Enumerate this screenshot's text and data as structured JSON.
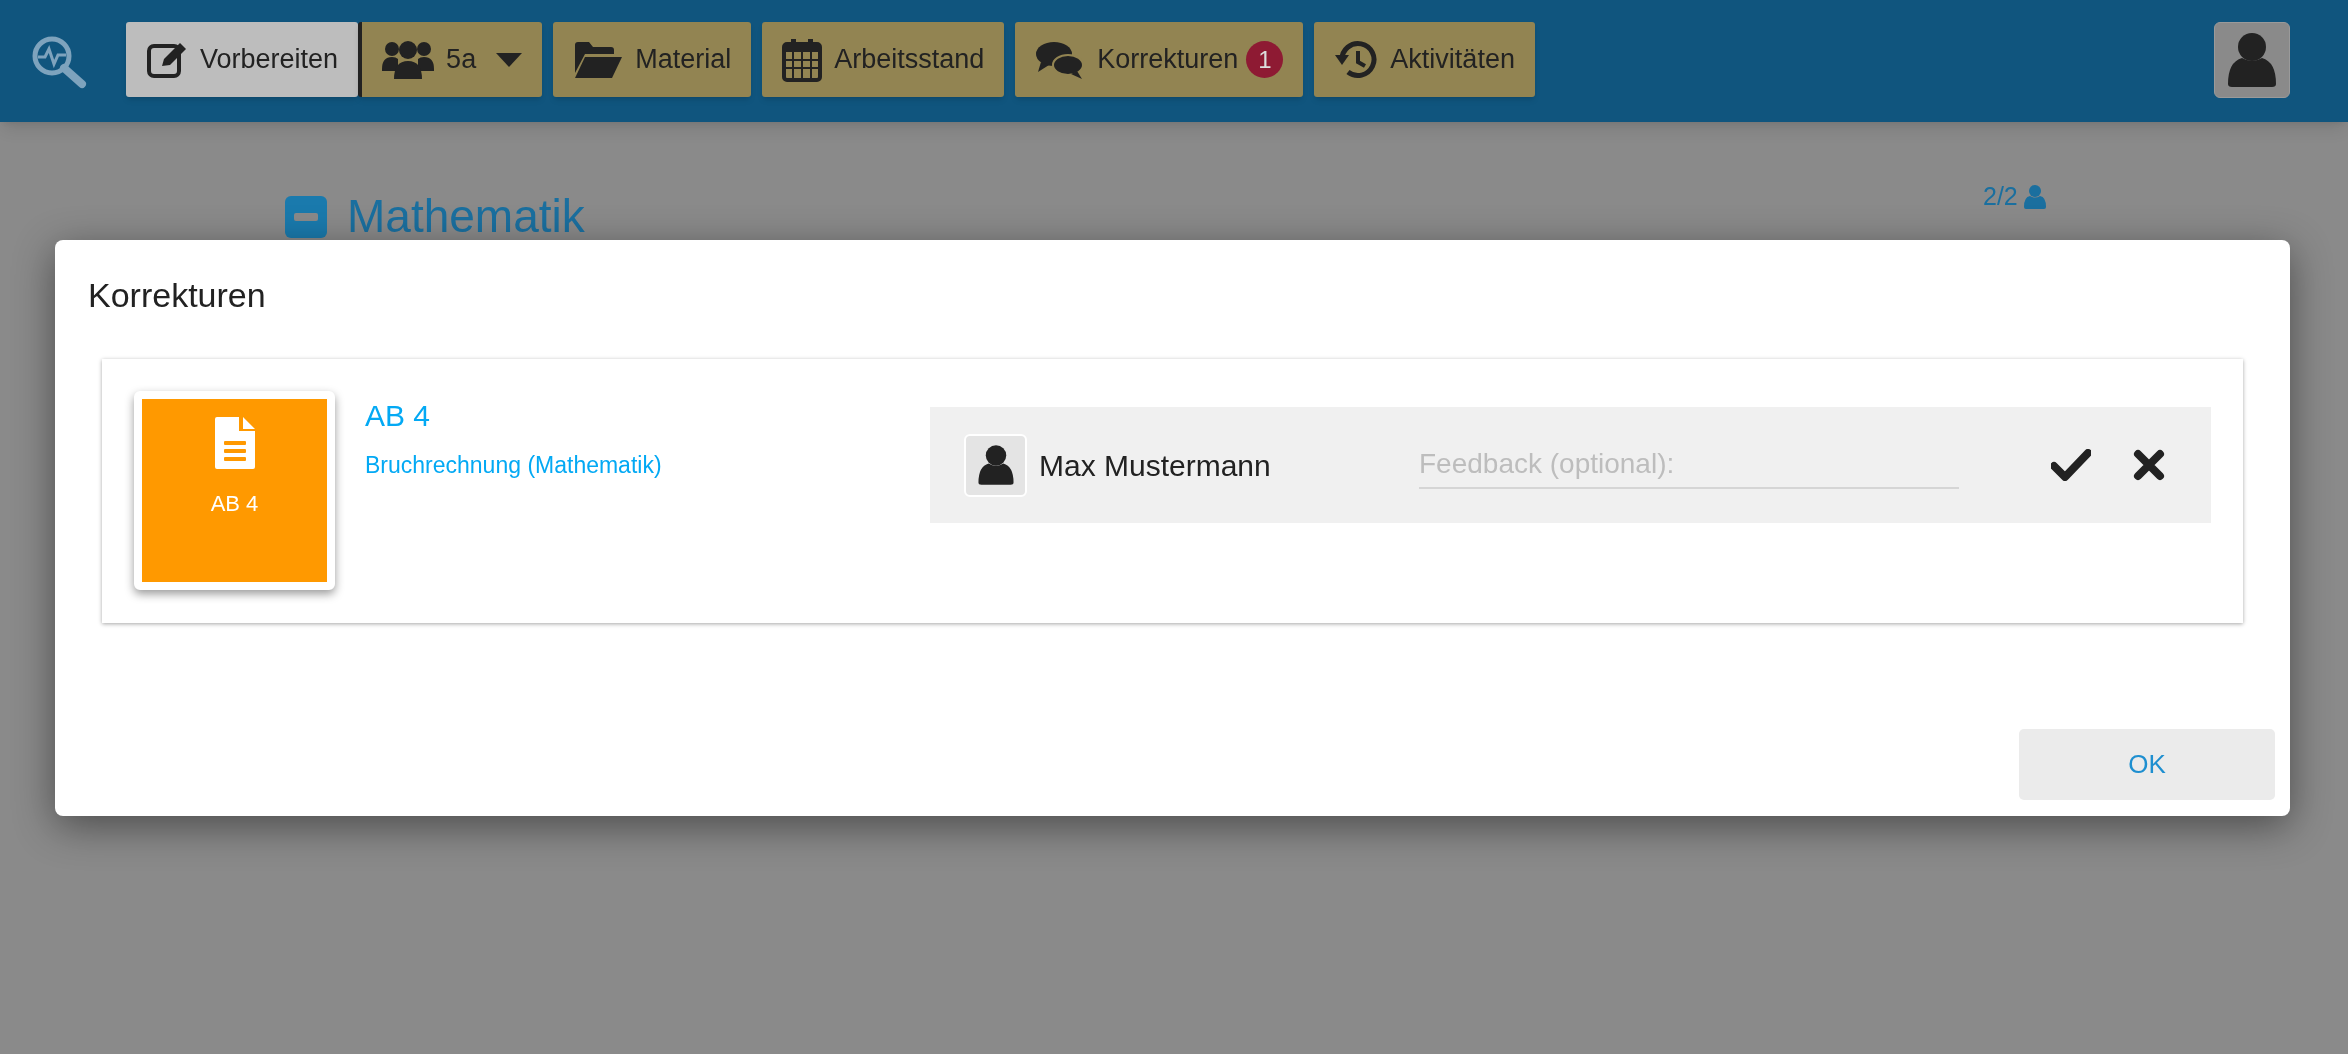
{
  "header": {
    "nav": [
      {
        "label": "Vorbereiten",
        "selected": true
      },
      {
        "label": "5a",
        "kind": "dropdown",
        "selected": false
      },
      {
        "label": "Material",
        "selected": false
      },
      {
        "label": "Arbeitsstand",
        "selected": false
      },
      {
        "label": "Korrekturen",
        "badge": "1",
        "selected": false
      },
      {
        "label": "Aktivitäten",
        "selected": false
      }
    ]
  },
  "page": {
    "heading": "Mathematik",
    "count": "2/2"
  },
  "dialog": {
    "title": "Korrekturen",
    "items": [
      {
        "thumb_label": "AB 4",
        "title": "AB 4",
        "subtitle": "Bruchrechnung (Mathematik)",
        "submissions": [
          {
            "student": "Max Mustermann",
            "feedback": {
              "placeholder": "Feedback (optional):"
            }
          }
        ]
      }
    ],
    "buttons": [
      "OK"
    ]
  }
}
